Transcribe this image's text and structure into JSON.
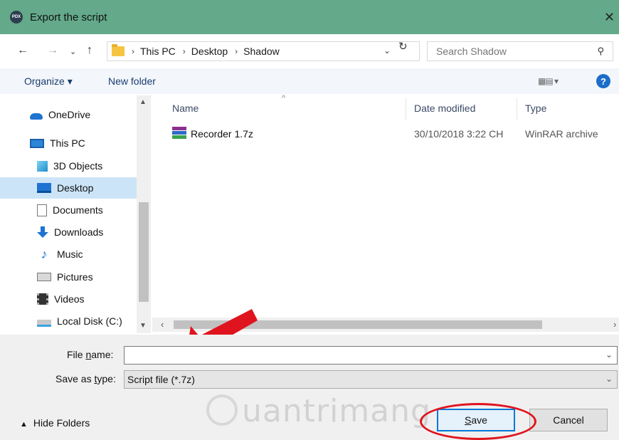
{
  "window": {
    "title": "Export the script",
    "app_icon_text": "PDX",
    "close_glyph": "✕"
  },
  "address": {
    "breadcrumbs": [
      "This PC",
      "Desktop",
      "Shadow"
    ],
    "search_placeholder": "Search Shadow"
  },
  "toolbar": {
    "organize_label": "Organize ▾",
    "new_folder_label": "New folder",
    "help_label": "?"
  },
  "sidebar": {
    "items": [
      {
        "label": "OneDrive",
        "icon": "onedrive-icon"
      },
      {
        "label": "This PC",
        "icon": "computer-icon"
      },
      {
        "label": "3D Objects",
        "icon": "cube-icon"
      },
      {
        "label": "Desktop",
        "icon": "desktop-icon",
        "selected": true
      },
      {
        "label": "Documents",
        "icon": "document-icon"
      },
      {
        "label": "Downloads",
        "icon": "download-icon"
      },
      {
        "label": "Music",
        "icon": "music-icon"
      },
      {
        "label": "Pictures",
        "icon": "picture-icon"
      },
      {
        "label": "Videos",
        "icon": "video-icon"
      },
      {
        "label": "Local Disk (C:)",
        "icon": "disk-icon"
      }
    ]
  },
  "filelist": {
    "columns": [
      "Name",
      "Date modified",
      "Type"
    ],
    "rows": [
      {
        "name": "Recorder 1.7z",
        "date_modified": "30/10/2018 3:22 CH",
        "type": "WinRAR archive",
        "icon": "winrar-icon"
      }
    ]
  },
  "form": {
    "file_name_label_prefix": "File ",
    "file_name_label_underlined": "n",
    "file_name_label_suffix": "ame:",
    "file_name_value": "",
    "save_type_label_prefix": "Save as ",
    "save_type_label_underlined": "t",
    "save_type_label_suffix": "ype:",
    "save_type_value": "Script file (*.7z)"
  },
  "footer": {
    "hide_folders_label": "Hide Folders",
    "save_button_underlined": "S",
    "save_button_rest": "ave",
    "cancel_button": "Cancel",
    "watermark_text": "uantrimang"
  },
  "colors": {
    "titlebar": "#63a98a",
    "selection": "#cce4f7",
    "accent": "#0078d7",
    "annotation": "#e0141e"
  }
}
